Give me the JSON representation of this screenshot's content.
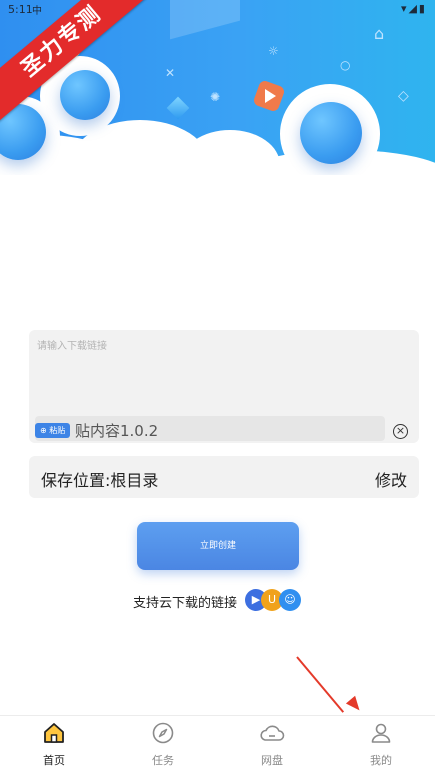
{
  "status_bar": {
    "time": "5:11",
    "carrier": "中"
  },
  "ribbon_text": "圣力专测",
  "link_input": {
    "placeholder": "请输入下载链接",
    "paste_button_label": "粘贴",
    "clipboard_text": "贴内容1.0.2"
  },
  "save_location": {
    "label": "保存位置:根目录",
    "edit_label": "修改"
  },
  "create_button_label": "立即创建",
  "support_text": "支持云下载的链接",
  "bottom_nav": {
    "items": [
      {
        "label": "首页",
        "icon": "home-icon",
        "active": true
      },
      {
        "label": "任务",
        "icon": "compass-icon",
        "active": false
      },
      {
        "label": "网盘",
        "icon": "cloud-icon",
        "active": false
      },
      {
        "label": "我的",
        "icon": "user-icon",
        "active": false
      }
    ]
  },
  "colors": {
    "banner_blue": "#2f8ff0",
    "accent": "#4b86e3",
    "ribbon_red": "#e32b2b",
    "arrow_red": "#e43a2a"
  }
}
